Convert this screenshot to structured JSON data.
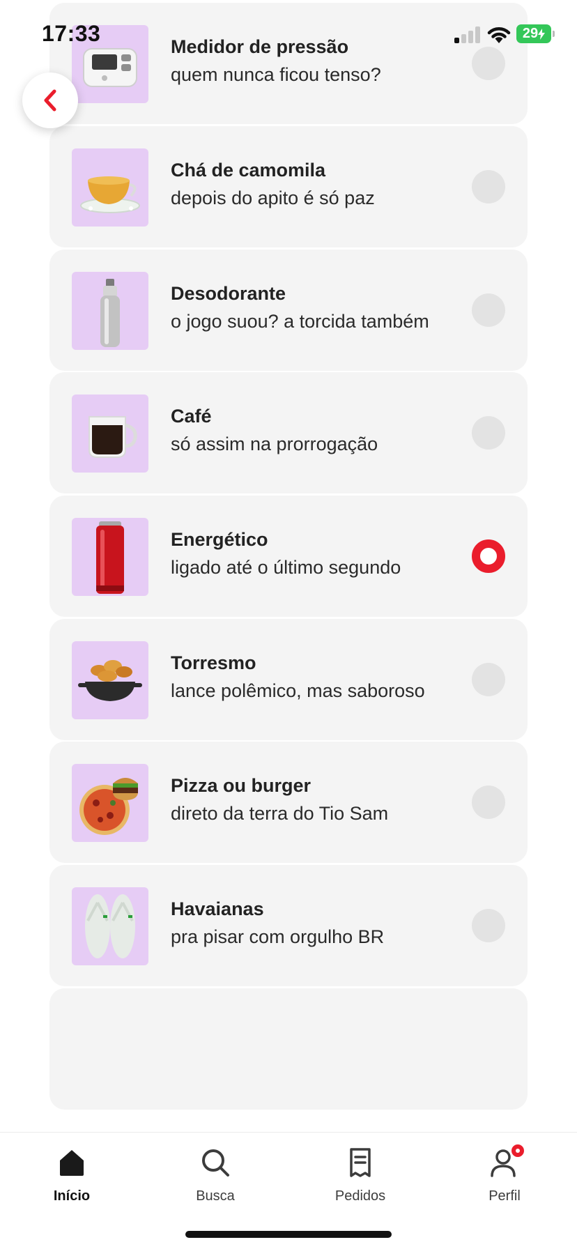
{
  "status_bar": {
    "time": "17:33",
    "battery": "29"
  },
  "items": [
    {
      "title": "Medidor de pressão",
      "subtitle": "quem nunca ficou tenso?",
      "icon": "blood-pressure-monitor-icon",
      "selected": false
    },
    {
      "title": "Chá de camomila",
      "subtitle": "depois do apito é só paz",
      "icon": "tea-cup-icon",
      "selected": false
    },
    {
      "title": "Desodorante",
      "subtitle": "o jogo suou? a torcida também",
      "icon": "deodorant-can-icon",
      "selected": false
    },
    {
      "title": "Café",
      "subtitle": "só assim na prorrogação",
      "icon": "coffee-cup-icon",
      "selected": false
    },
    {
      "title": "Energético",
      "subtitle": "ligado até o último segundo",
      "icon": "energy-drink-can-icon",
      "selected": true
    },
    {
      "title": "Torresmo",
      "subtitle": "lance polêmico, mas saboroso",
      "icon": "pork-rinds-bowl-icon",
      "selected": false
    },
    {
      "title": "Pizza ou burger",
      "subtitle": "direto da terra do Tio Sam",
      "icon": "pizza-burger-icon",
      "selected": false
    },
    {
      "title": "Havaianas",
      "subtitle": "pra pisar com orgulho BR",
      "icon": "flip-flops-icon",
      "selected": false
    }
  ],
  "bottom_nav": [
    {
      "label": "Início",
      "icon": "home-icon",
      "active": true
    },
    {
      "label": "Busca",
      "icon": "search-icon",
      "active": false
    },
    {
      "label": "Pedidos",
      "icon": "receipt-icon",
      "active": false
    },
    {
      "label": "Perfil",
      "icon": "profile-icon",
      "active": false,
      "badge": true
    }
  ],
  "colors": {
    "accent": "#ea1d2c",
    "card_bg": "#f4f4f4",
    "thumb_bg": "#e6ccf5",
    "radio_off": "#e3e3e3"
  }
}
